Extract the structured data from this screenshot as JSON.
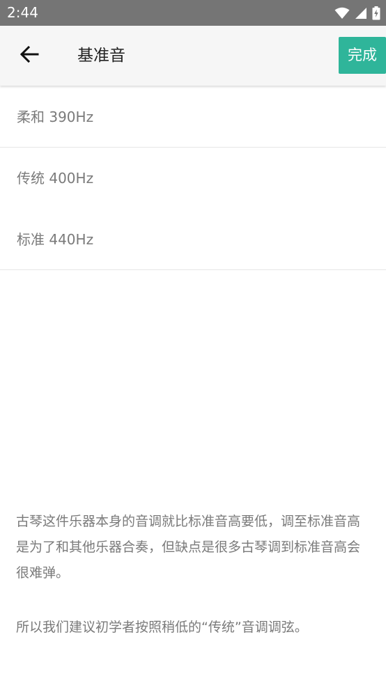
{
  "status_bar": {
    "time": "2:44",
    "icons": [
      "wifi-icon",
      "signal-icon",
      "battery-charging-icon"
    ]
  },
  "app_bar": {
    "back_icon": "arrow-left-icon",
    "title": "基准音",
    "done_label": "完成",
    "accent_color": "#2fb59a"
  },
  "options": [
    {
      "label": "柔和 390Hz"
    },
    {
      "label": "传统 400Hz"
    },
    {
      "label": "标准 440Hz"
    }
  ],
  "description": "古琴这件乐器本身的音调就比标准音高要低，调至标准音高是为了和其他乐器合奏，但缺点是很多古琴调到标准音高会很难弹。",
  "note": "所以我们建议初学者按照稍低的“传统”音调调弦。"
}
